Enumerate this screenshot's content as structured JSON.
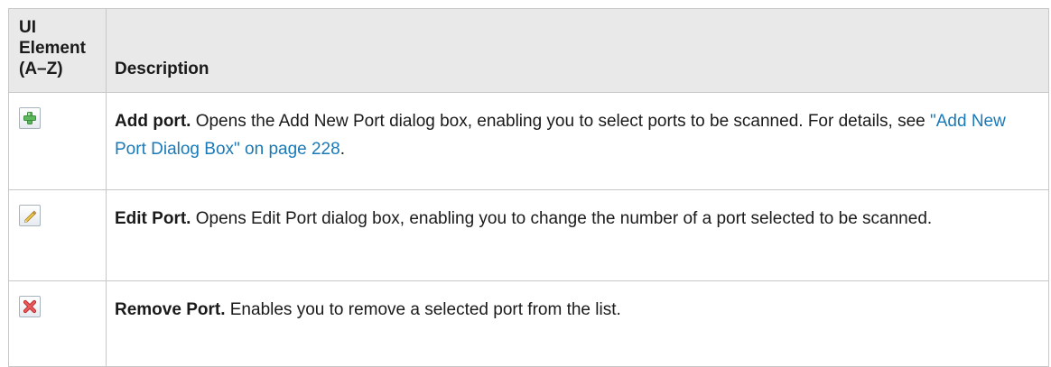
{
  "table": {
    "header": {
      "ui_element": "UI Element (A–Z)",
      "description": "Description"
    },
    "rows": [
      {
        "icon": "add-plus-icon",
        "title": "Add port.",
        "text_before_link": " Opens the Add New Port dialog box, enabling you to select ports to be scanned. For details, see ",
        "link": "\"Add New Port Dialog Box\" on page 228",
        "text_after_link": "."
      },
      {
        "icon": "edit-pencil-icon",
        "title": "Edit Port.",
        "text": " Opens Edit Port dialog box, enabling you to change the number of a port selected to be scanned."
      },
      {
        "icon": "remove-x-icon",
        "title": "Remove Port.",
        "text": " Enables you to remove a selected port from the list."
      }
    ]
  },
  "colors": {
    "header_bg": "#e9e9e9",
    "border": "#c8c8c8",
    "link": "#1a7ab8"
  }
}
